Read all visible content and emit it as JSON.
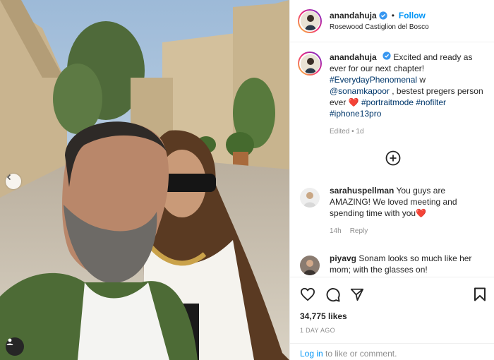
{
  "post": {
    "username": "anandahuja",
    "follow_label": "Follow",
    "separator": "•",
    "location": "Rosewood Castiglion del Bosco"
  },
  "caption": {
    "username": "anandahuja",
    "text1": "Excited and ready as ever for our next chapter!",
    "tag_everyday": "#EverydayPhenomenal",
    "text_w": " w ",
    "mention": "@sonamkapoor",
    "text2": " , bestest pregers person ever ",
    "heart": "❤️",
    "tags_end": "#portraitmode #nofilter #iphone13pro",
    "meta": "Edited • 1d"
  },
  "comments": [
    {
      "username": "sarahuspellman",
      "text": "You guys are AMAZING! We loved meeting and spending time with you",
      "heart": "❤️",
      "time": "14h",
      "reply_label": "Reply"
    },
    {
      "username": "piyavg",
      "text": "Sonam looks so much like her mom; with the glasses on!"
    }
  ],
  "actions": {
    "likes": "34,775 likes",
    "date": "1 DAY AGO"
  },
  "login": {
    "link_label": "Log in",
    "rest": " to like or comment."
  },
  "icons": {
    "verified": "verified-badge-icon",
    "prev": "chevron-left-icon",
    "tag": "user-tag-icon",
    "load": "plus-circle-icon",
    "like": "heart-outline-icon",
    "comment": "comment-icon",
    "share": "paper-plane-icon",
    "save": "bookmark-icon"
  },
  "colors": {
    "accent": "#0095f6",
    "verified": "#3897f0",
    "heart": "#e0245e",
    "muted": "#8e8e8e",
    "tag": "#00376b"
  }
}
